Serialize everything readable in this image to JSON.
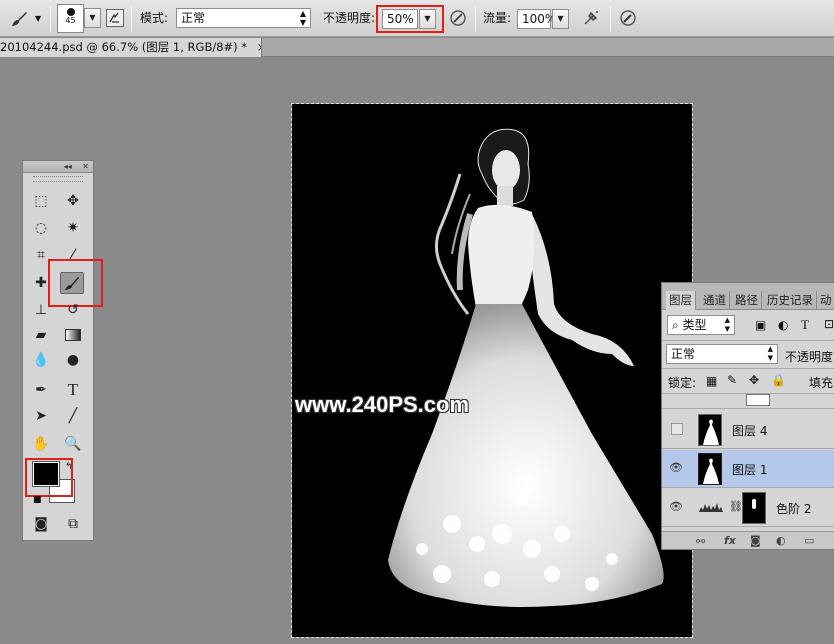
{
  "options_bar": {
    "brush_size": "45",
    "mode_label": "模式:",
    "mode_value": "正常",
    "opacity_label": "不透明度:",
    "opacity_value": "50%",
    "flow_label": "流量:",
    "flow_value": "100%"
  },
  "document_tab": {
    "title": "20104244.psd @ 66.7% (图层 1, RGB/8#) *",
    "close": "×"
  },
  "canvas": {
    "watermark": "www.240PS.com"
  },
  "tools_panel": {
    "collapse": "◂◂",
    "close": "✕"
  },
  "layers_panel": {
    "tabs": [
      "图层",
      "通道",
      "路径",
      "历史记录",
      "动"
    ],
    "filter_kind": "类型",
    "blend_mode": "正常",
    "opacity_label": "不透明度",
    "lock_label": "锁定:",
    "fill_label": "填充",
    "layers": [
      {
        "name": "图层 4",
        "visible": false,
        "selected": false
      },
      {
        "name": "图层 1",
        "visible": true,
        "selected": true
      },
      {
        "name": "色阶 2",
        "visible": true,
        "selected": false
      }
    ]
  },
  "colors": {
    "foreground": "#000000",
    "background": "#ffffff",
    "highlight": "#e0201b",
    "selected_layer": "#b6c8ea"
  }
}
